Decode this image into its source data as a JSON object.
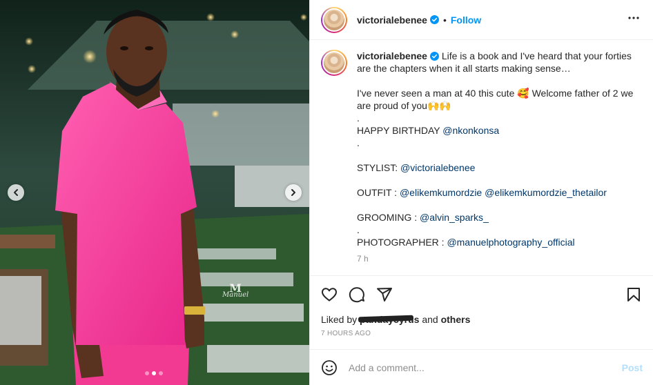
{
  "post": {
    "username": "victorialebenee",
    "follow_label": "Follow",
    "separator": "•",
    "more_icon": "more-horizontal-icon",
    "verified_icon": "verified-badge-icon",
    "verified_color": "#0095f6"
  },
  "caption": {
    "username": "victorialebenee",
    "lines": [
      "Life is a book and I've heard that your forties are the chapters when it all starts making sense…",
      "",
      "I've never seen a man at 40 this cute 🥰 Welcome father of 2 we are proud of you🙌🙌",
      ".",
      "HAPPY BIRTHDAY @nkonkonsa",
      ".",
      "",
      "STYLIST: @victorialebenee",
      "",
      "OUTFIT : @elikemkumordzie @elikemkumordzie_thetailor",
      "",
      "GROOMING : @alvin_sparks_",
      ".",
      "PHOTOGRAPHER : @manuelphotography_official"
    ],
    "time": "7 h"
  },
  "actions": {
    "like_icon": "heart-icon",
    "comment_icon": "comment-icon",
    "share_icon": "share-icon",
    "save_icon": "bookmark-icon"
  },
  "likes": {
    "prefix": "Liked by",
    "user": "pandaycyrus",
    "middle": "and",
    "suffix": "others"
  },
  "posted_ago": "7 HOURS AGO",
  "comment": {
    "placeholder": "Add a comment...",
    "post_label": "Post",
    "emoji_icon": "emoji-icon"
  },
  "carousel": {
    "slides": 3,
    "active": 1,
    "watermark_mark": "M",
    "watermark_text": "Manuel",
    "prev_icon": "chevron-left-icon",
    "next_icon": "chevron-right-icon"
  },
  "colors": {
    "accent": "#0095f6",
    "shirt": "#ff3d9a",
    "background_green": "#1d2a24"
  }
}
